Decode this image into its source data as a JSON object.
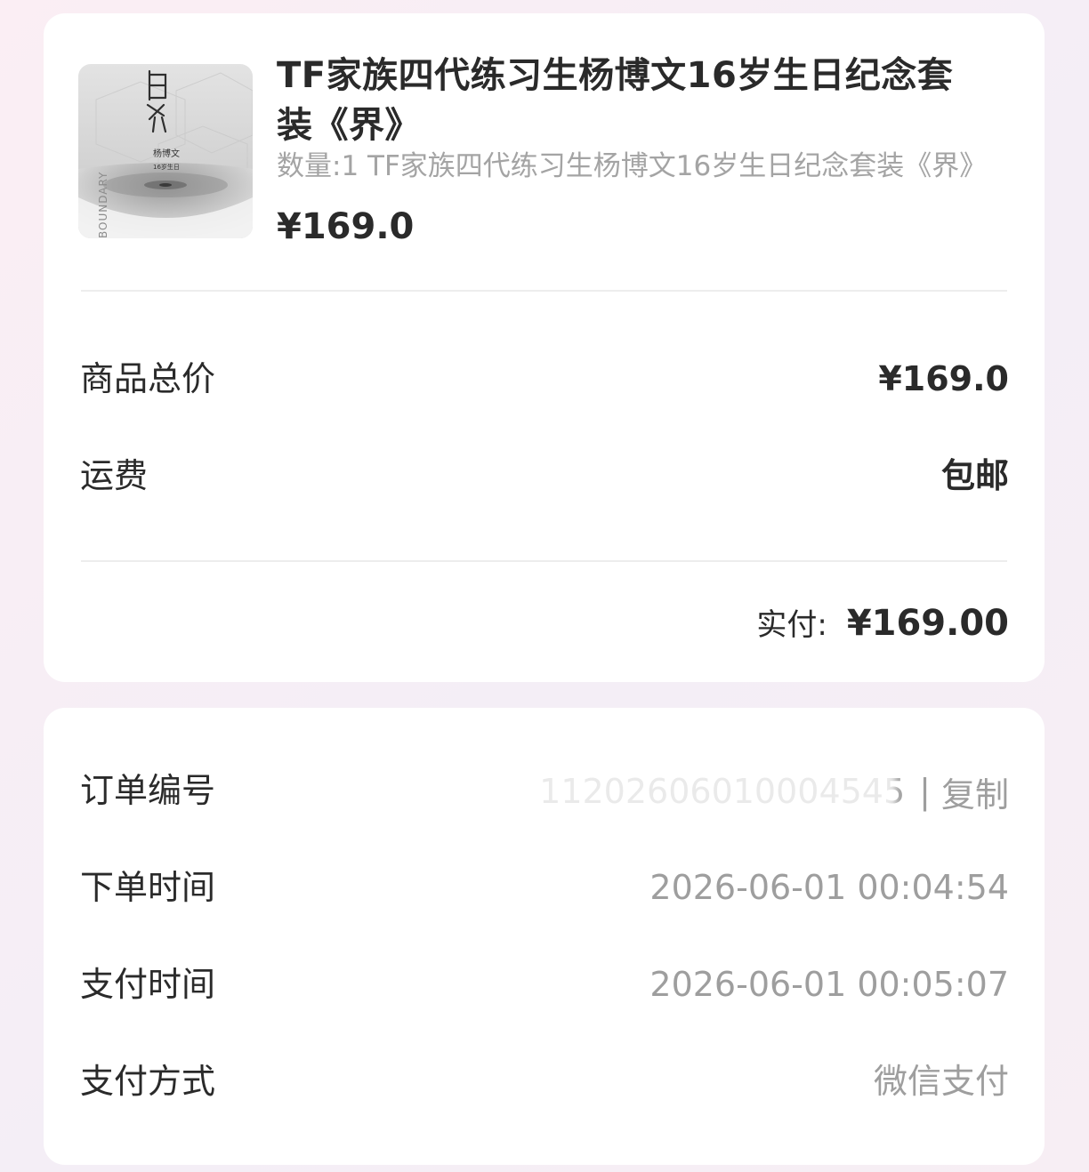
{
  "product": {
    "title": "TF家族四代练习生杨博文16岁生日纪念套装《界》",
    "description": "数量:1 TF家族四代练习生杨博文16岁生日纪念套装《界》",
    "price": "¥169.0",
    "thumbnail_text": {
      "main": "界",
      "name": "杨博文",
      "sub": "16岁生日",
      "side": "BOUNDARY"
    }
  },
  "summary": {
    "subtotal_label": "商品总价",
    "subtotal_value": "¥169.0",
    "shipping_label": "运费",
    "shipping_value": "包邮",
    "paid_label": "实付:",
    "paid_value": "¥169.00"
  },
  "info": {
    "order_no_label": "订单编号",
    "order_no_value": "11202606010004545",
    "copy_label": "复制",
    "separator": "|",
    "order_time_label": "下单时间",
    "order_time_value": "2026-06-01 00:04:54",
    "pay_time_label": "支付时间",
    "pay_time_value": "2026-06-01 00:05:07",
    "pay_method_label": "支付方式",
    "pay_method_value": "微信支付"
  },
  "colors": {
    "text_primary": "#2a2a2a",
    "text_secondary": "#9e9e9e",
    "card_bg": "#ffffff",
    "page_bg": "#f6eef5",
    "divider": "#ededed"
  }
}
